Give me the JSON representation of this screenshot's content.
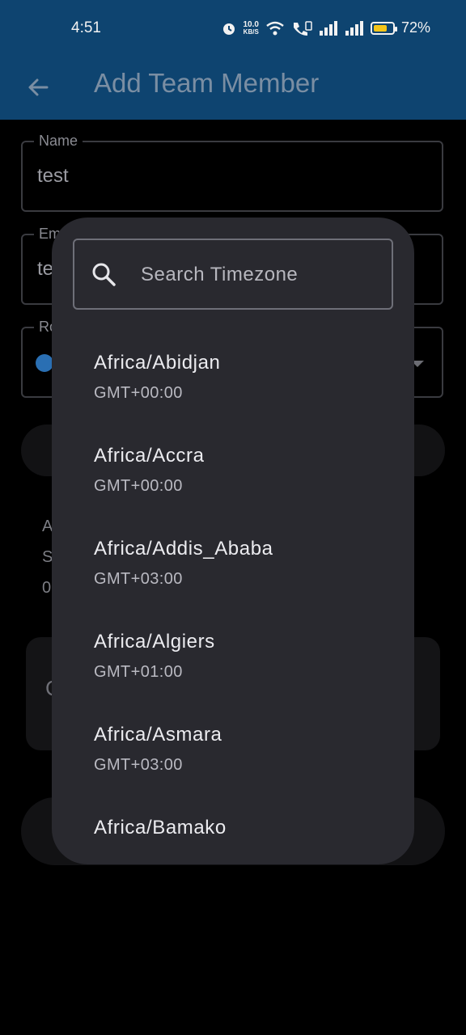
{
  "status_bar": {
    "time": "4:51",
    "net_speed_value": "10.0",
    "net_speed_unit": "KB/S",
    "battery_percent": "72%",
    "battery_level": 0.72
  },
  "app_bar": {
    "title": "Add Team Member"
  },
  "form": {
    "name_label": "Name",
    "name_value": "test",
    "email_label_partial": "Em",
    "email_value_partial": "te",
    "role_label_partial": "Ro",
    "stub_lines": [
      "A",
      "S",
      "0"
    ],
    "card_char": "C"
  },
  "dialog": {
    "search_placeholder": "Search Timezone",
    "items": [
      {
        "name": "Africa/Abidjan",
        "offset": "GMT+00:00"
      },
      {
        "name": "Africa/Accra",
        "offset": "GMT+00:00"
      },
      {
        "name": "Africa/Addis_Ababa",
        "offset": "GMT+03:00"
      },
      {
        "name": "Africa/Algiers",
        "offset": "GMT+01:00"
      },
      {
        "name": "Africa/Asmara",
        "offset": "GMT+03:00"
      },
      {
        "name": "Africa/Bamako",
        "offset": ""
      }
    ]
  }
}
